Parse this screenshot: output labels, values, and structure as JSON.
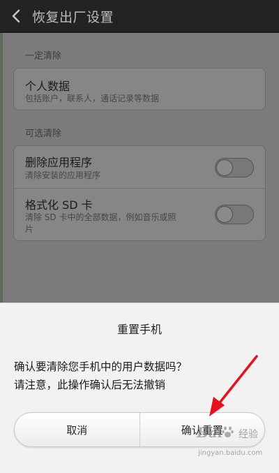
{
  "header": {
    "title": "恢复出厂设置"
  },
  "sections": {
    "required_label": "一定清除",
    "optional_label": "可选清除"
  },
  "required_items": [
    {
      "title": "个人数据",
      "subtitle": "包括账户，联系人，通话记录等数据"
    }
  ],
  "optional_items": [
    {
      "title": "删除应用程序",
      "subtitle": "清除安装的应用程序",
      "toggle_on": false
    },
    {
      "title": "格式化 SD 卡",
      "subtitle_line1": "清除 SD 卡中的全部数据，例如音乐或照",
      "subtitle_line2": "片",
      "toggle_on": false
    }
  ],
  "dialog": {
    "title": "重置手机",
    "message_line1": "确认要清除您手机中的用户数据吗？",
    "message_line2": "请注意，此操作确认后无法撤销",
    "cancel_label": "取消",
    "confirm_label": "确认重置"
  },
  "watermark": {
    "brand_left": "Bai",
    "brand_right": "经验",
    "url": "jingyan.baidu.com"
  },
  "colors": {
    "annotation_arrow": "#e8101a",
    "titlebar": "#232323",
    "dialog_bg": "#f2f2f2"
  },
  "icons": {
    "back": "chevron-left-icon",
    "watermark_logo": "baidu-paw-icon"
  }
}
